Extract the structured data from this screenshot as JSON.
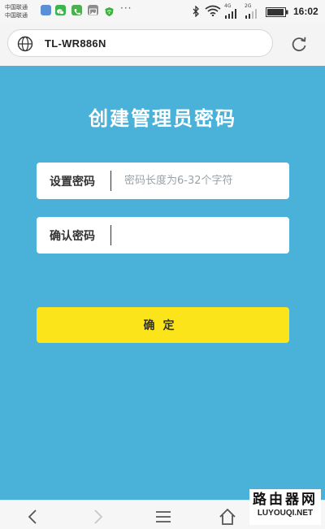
{
  "status_bar": {
    "carrier_1": "中国联通",
    "carrier_2": "中国联通",
    "more": "···",
    "net_4g": "4G",
    "net_2g": "2G",
    "time": "16:02",
    "app_icons": [
      "#5a8fd8",
      "#3cb44a",
      "#4caf50",
      "#8d8d8d",
      "#3db03d"
    ]
  },
  "address_bar": {
    "url": "TL-WR886N"
  },
  "main": {
    "title": "创建管理员密码",
    "set_password": {
      "label": "设置密码",
      "placeholder": "密码长度为6-32个字符",
      "value": ""
    },
    "confirm_password": {
      "label": "确认密码",
      "placeholder": "",
      "value": ""
    },
    "confirm_button": "确定"
  },
  "watermark": {
    "chinese": "路由器网",
    "english": "LUYOUQI.NET"
  },
  "colors": {
    "background": "#4ab2d8",
    "button": "#fbe51a",
    "field": "#ffffff"
  }
}
